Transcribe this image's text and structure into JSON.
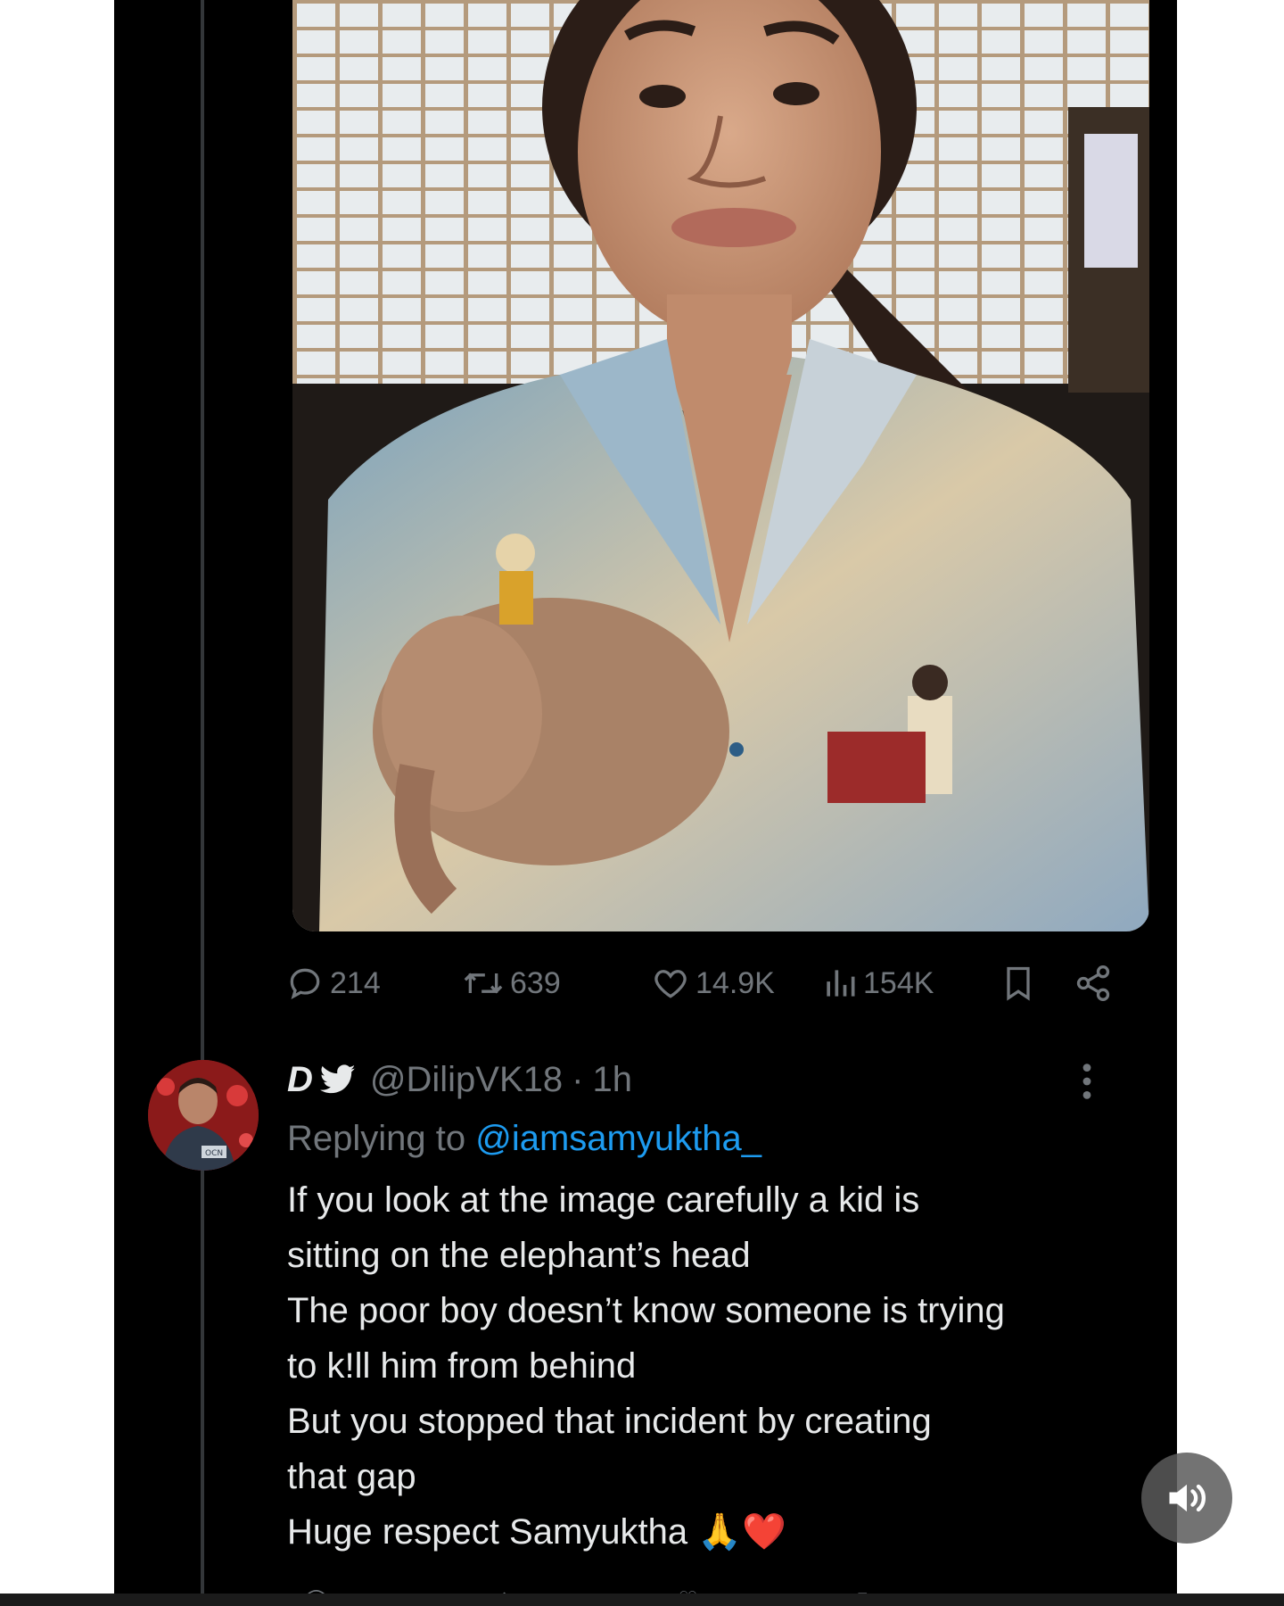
{
  "tweet": {
    "stats": {
      "replies": "214",
      "retweets": "639",
      "likes": "14.9K",
      "views": "154K"
    }
  },
  "reply": {
    "name": "D",
    "handle": "@DilipVK18",
    "separator": "·",
    "time": "1h",
    "replying_prefix": "Replying to",
    "replying_mention": "@iamsamyuktha_",
    "lines": [
      "If you look at the image carefully a kid is",
      "sitting on the elephant’s head",
      "The poor boy doesn’t know someone is trying",
      "to k!ll him from behind",
      "But you stopped that incident by creating",
      "that gap",
      "Huge respect Samyuktha"
    ],
    "emoji": "🙏❤️",
    "avatar_text": "OCN"
  },
  "colors": {
    "background": "#000000",
    "text_primary": "#e7e9ea",
    "text_secondary": "#71767b",
    "link": "#1d9bf0"
  },
  "icons": [
    "reply-icon",
    "retweet-icon",
    "like-icon",
    "views-icon",
    "bookmark-icon",
    "share-icon",
    "bird-icon",
    "more-icon",
    "volume-icon"
  ]
}
